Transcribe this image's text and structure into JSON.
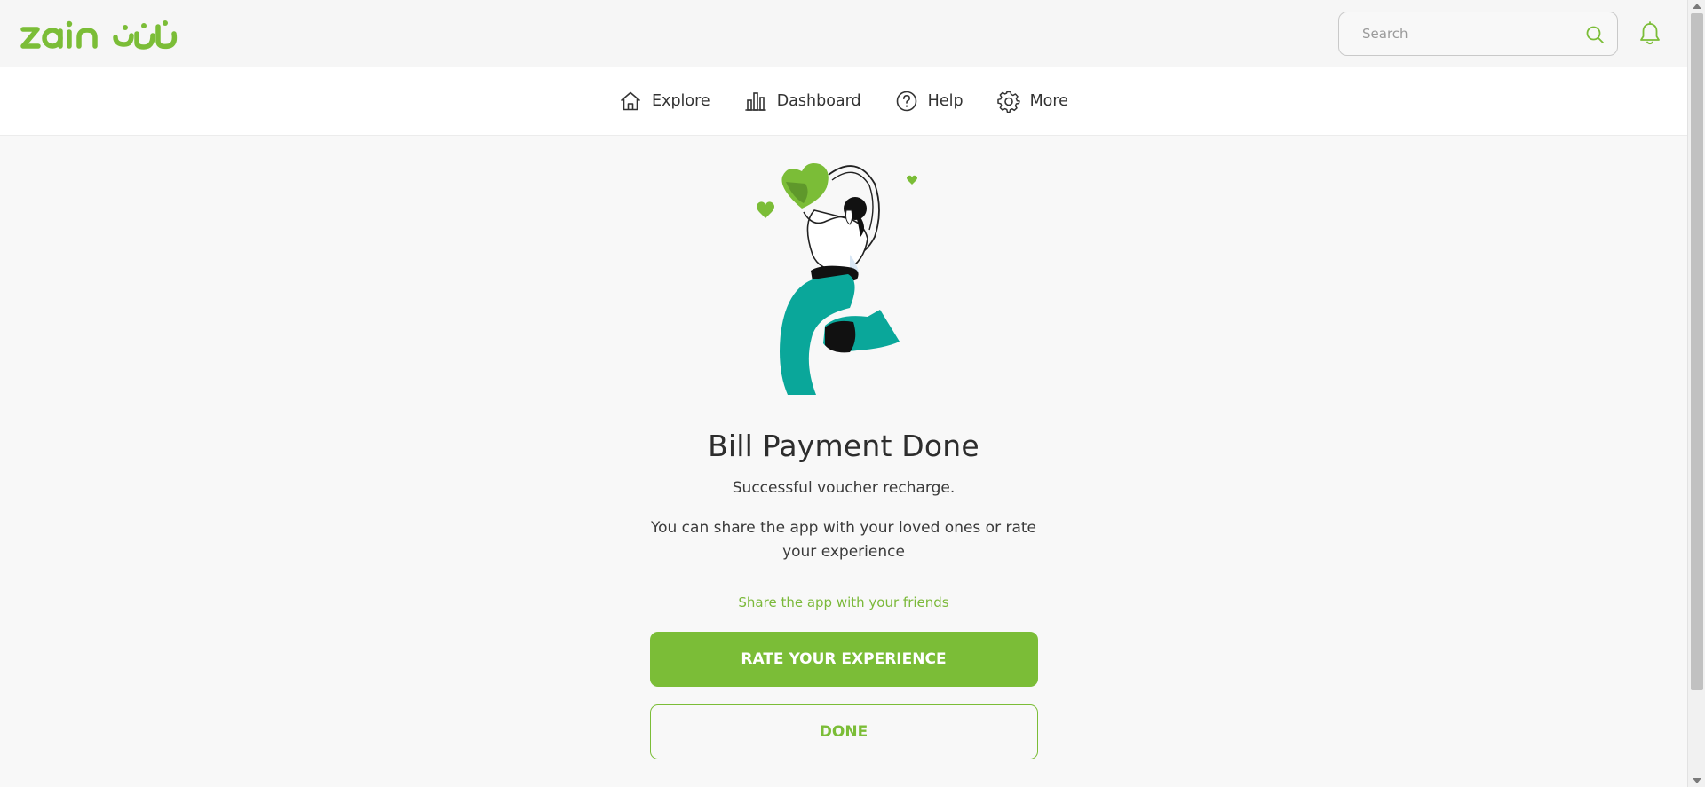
{
  "brand": {
    "name": "zain",
    "accent_color": "#7bbd37",
    "logo_icon": "zain-logo-icon"
  },
  "header": {
    "search_placeholder": "Search",
    "search_icon": "search-icon",
    "notification_icon": "bell-icon"
  },
  "nav": {
    "items": [
      {
        "label": "Explore",
        "icon": "home-icon"
      },
      {
        "label": "Dashboard",
        "icon": "bar-chart-icon"
      },
      {
        "label": "Help",
        "icon": "question-circle-icon"
      },
      {
        "label": "More",
        "icon": "gear-icon"
      }
    ]
  },
  "main": {
    "illustration": "woman-holding-heart-illustration",
    "title": "Bill Payment Done",
    "subtitle": "Successful voucher recharge.",
    "description": "You can share the app with your loved ones or rate your experience",
    "share_link": "Share the app with your friends",
    "rate_button": "RATE YOUR EXPERIENCE",
    "done_button": "DONE"
  }
}
